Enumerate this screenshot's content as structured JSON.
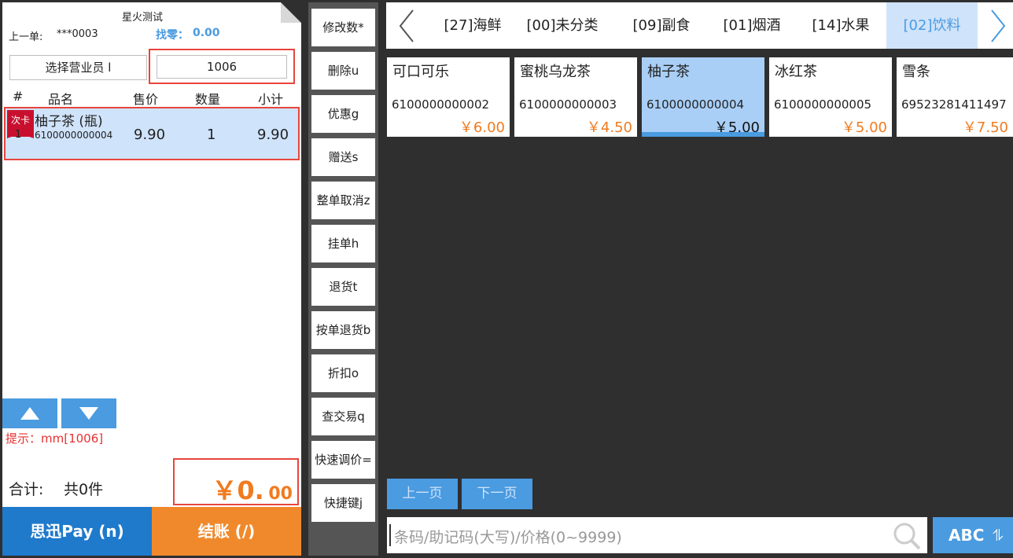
{
  "header": {
    "store_name": "星火测试",
    "prev_order_label": "上一单:",
    "prev_order_value": "***0003",
    "change_label": "找零：",
    "change_value": "0.00"
  },
  "staff": {
    "select_label": "选择营业员 l",
    "value": "1006"
  },
  "cart": {
    "columns": [
      "#",
      "品名",
      "售价",
      "数量",
      "小计"
    ],
    "rows": [
      {
        "tag": "次卡",
        "index": "1",
        "name": "柚子茶 (瓶)",
        "code": "6100000000004",
        "price": "9.90",
        "qty": "1",
        "subtotal": "9.90"
      }
    ]
  },
  "hint": "提示：mm[1006]",
  "totals": {
    "label": "合计:",
    "count": "共0件",
    "amount_main": "￥0.",
    "amount_decimal": "00"
  },
  "actions": {
    "pay": "思迅Pay (n)",
    "settle": "结账 (/)"
  },
  "functions": [
    "修改数*",
    "删除u",
    "优惠g",
    "赠送s",
    "整单取消z",
    "挂单h",
    "退货t",
    "按单退货b",
    "折扣o",
    "查交易q",
    "快速调价=",
    "快捷键j"
  ],
  "categories": [
    {
      "label": "[27]海鲜",
      "active": false
    },
    {
      "label": "[00]未分类",
      "active": false
    },
    {
      "label": "[09]副食",
      "active": false
    },
    {
      "label": "[01]烟酒",
      "active": false
    },
    {
      "label": "[14]水果",
      "active": false
    },
    {
      "label": "[02]饮料",
      "active": true
    }
  ],
  "products": [
    {
      "name": "可口可乐",
      "code": "6100000000002",
      "price": "￥6.00",
      "selected": false
    },
    {
      "name": "蜜桃乌龙茶",
      "code": "6100000000003",
      "price": "￥4.50",
      "selected": false
    },
    {
      "name": "柚子茶",
      "code": "6100000000004",
      "price": "￥5.00",
      "selected": true
    },
    {
      "name": "冰红茶",
      "code": "6100000000005",
      "price": "￥5.00",
      "selected": false
    },
    {
      "name": "雪条",
      "code": "69523281411497",
      "price": "￥7.50",
      "selected": false
    }
  ],
  "pagination": {
    "prev": "上一页",
    "next": "下一页"
  },
  "search": {
    "placeholder": "条码/助记码(大写)/价格(0~9999)"
  },
  "input_mode": {
    "label": "ABC",
    "icon": "⥮"
  },
  "colors": {
    "accent": "#4a9be0",
    "pay": "#1f7acc",
    "settle": "#f07b20",
    "alert": "#e8453c",
    "price": "#f07b20"
  }
}
